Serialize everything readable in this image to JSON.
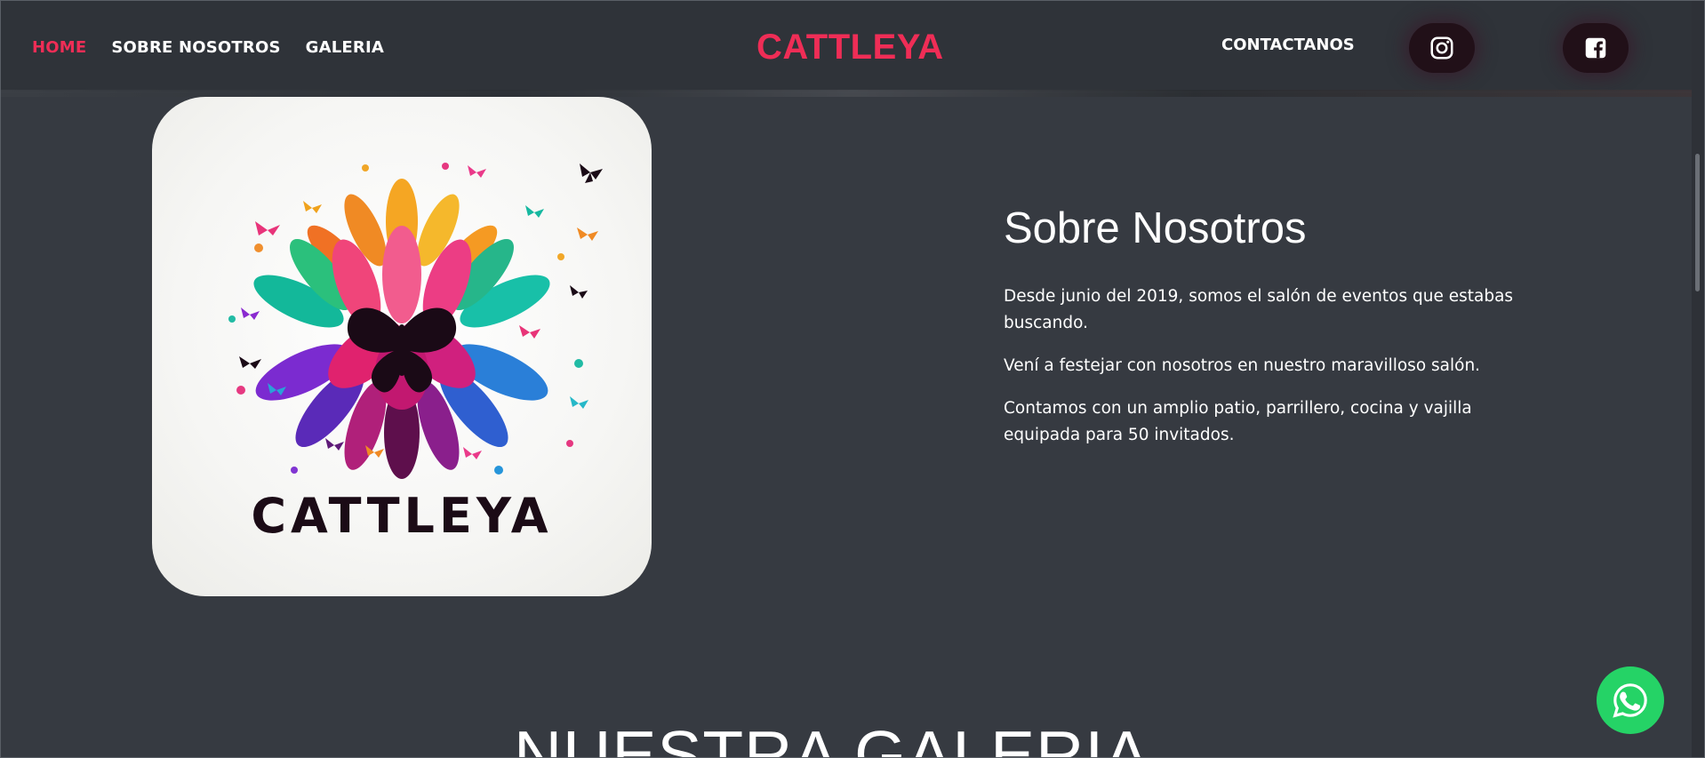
{
  "nav": {
    "links": [
      {
        "label": "HOME",
        "active": true
      },
      {
        "label": "SOBRE NOSOTROS",
        "active": false
      },
      {
        "label": "GALERIA",
        "active": false
      }
    ],
    "brand": "CATTLEYA",
    "contact": "CONTACTANOS",
    "social": [
      {
        "icon": "instagram-icon"
      },
      {
        "icon": "facebook-icon"
      }
    ]
  },
  "logo": {
    "wordmark": "CATTLEYA",
    "icon": "butterfly-flower-logo"
  },
  "about": {
    "title": "Sobre Nosotros",
    "paragraphs": [
      "Desde junio del 2019, somos el salón de eventos que estabas buscando.",
      "Vení a festejar con nosotros en nuestro maravilloso salón.",
      "Contamos con un amplio patio, parrillero, cocina y vajilla equipada para 50 invitados."
    ]
  },
  "gallery": {
    "title": "NUESTRA GALERIA"
  },
  "whatsapp": {
    "icon": "whatsapp-icon"
  },
  "colors": {
    "accent": "#ef2d56",
    "background": "#363a41",
    "whatsapp": "#25d366"
  }
}
